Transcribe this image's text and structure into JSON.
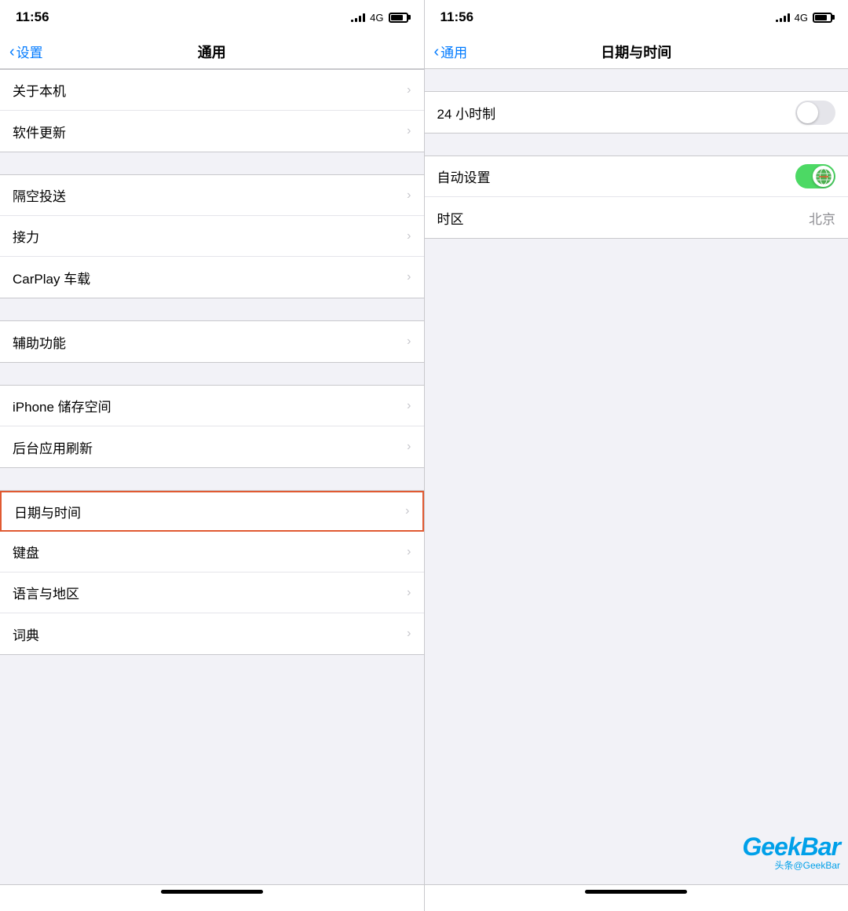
{
  "left_screen": {
    "status_bar": {
      "time": "11:56",
      "signal_label": "4G"
    },
    "nav": {
      "back_label": "设置",
      "title": "通用"
    },
    "sections": [
      {
        "id": "section1",
        "items": [
          {
            "id": "about",
            "label": "关于本机",
            "has_chevron": true
          },
          {
            "id": "software",
            "label": "软件更新",
            "has_chevron": true
          }
        ]
      },
      {
        "id": "section2",
        "items": [
          {
            "id": "airdrop",
            "label": "隔空投送",
            "has_chevron": true
          },
          {
            "id": "handoff",
            "label": "接力",
            "has_chevron": true
          },
          {
            "id": "carplay",
            "label": "CarPlay 车载",
            "has_chevron": true
          }
        ]
      },
      {
        "id": "section3",
        "items": [
          {
            "id": "accessibility",
            "label": "辅助功能",
            "has_chevron": true
          }
        ]
      },
      {
        "id": "section4",
        "items": [
          {
            "id": "storage",
            "label": "iPhone 储存空间",
            "has_chevron": true
          },
          {
            "id": "background",
            "label": "后台应用刷新",
            "has_chevron": true
          }
        ]
      },
      {
        "id": "section5",
        "items": [
          {
            "id": "datetime",
            "label": "日期与时间",
            "has_chevron": true,
            "highlighted": true
          },
          {
            "id": "keyboard",
            "label": "键盘",
            "has_chevron": true
          },
          {
            "id": "language",
            "label": "语言与地区",
            "has_chevron": true
          },
          {
            "id": "dictionary",
            "label": "词典",
            "has_chevron": true
          }
        ]
      }
    ]
  },
  "right_screen": {
    "status_bar": {
      "time": "11:56",
      "signal_label": "4G"
    },
    "nav": {
      "back_label": "通用",
      "title": "日期与时间"
    },
    "sections": [
      {
        "id": "section1",
        "items": []
      },
      {
        "id": "section2",
        "items": [
          {
            "id": "24hour",
            "label": "24 小时制",
            "type": "toggle",
            "value": false
          }
        ]
      },
      {
        "id": "section3",
        "items": [
          {
            "id": "autoset",
            "label": "自动设置",
            "type": "toggle_globe",
            "value": true
          },
          {
            "id": "timezone",
            "label": "时区",
            "type": "value",
            "value": "北京"
          }
        ]
      }
    ],
    "watermark": {
      "logo": "GeekBar",
      "sub": "头条@GeekBar"
    }
  },
  "icons": {
    "chevron": "›",
    "back_arrow": "‹"
  }
}
